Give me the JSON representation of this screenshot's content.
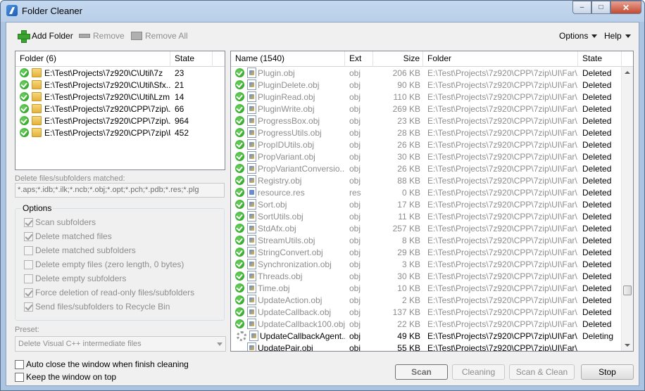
{
  "window": {
    "title": "Folder Cleaner",
    "minimize": "–",
    "maximize": "□",
    "close": "✕"
  },
  "toolbar": {
    "add_folder": "Add Folder",
    "remove": "Remove",
    "remove_all": "Remove All",
    "options": "Options",
    "help": "Help"
  },
  "folders": {
    "col_folder": "Folder (6)",
    "col_state": "State",
    "rows": [
      {
        "path": "E:\\Test\\Projects\\7z920\\C\\Util\\7z",
        "state": "23"
      },
      {
        "path": "E:\\Test\\Projects\\7z920\\C\\Util\\Sfx...",
        "state": "21"
      },
      {
        "path": "E:\\Test\\Projects\\7z920\\C\\Util\\Lzm...",
        "state": "14"
      },
      {
        "path": "E:\\Test\\Projects\\7z920\\CPP\\7zip\\...",
        "state": "66"
      },
      {
        "path": "E:\\Test\\Projects\\7z920\\CPP\\7zip\\...",
        "state": "964"
      },
      {
        "path": "E:\\Test\\Projects\\7z920\\CPP\\7zip\\UI",
        "state": "452"
      }
    ]
  },
  "delete_label": "Delete files/subfolders matched:",
  "delete_pattern": "*.aps;*.idb;*.ilk;*.ncb;*.obj;*.opt;*.pch;*.pdb;*.res;*.plg",
  "options": {
    "title": "Options",
    "items": [
      {
        "label": "Scan subfolders",
        "checked": true
      },
      {
        "label": "Delete matched files",
        "checked": true
      },
      {
        "label": "Delete matched subfolders",
        "checked": false
      },
      {
        "label": "Delete empty files (zero length, 0 bytes)",
        "checked": false
      },
      {
        "label": "Delete empty subfolders",
        "checked": false
      },
      {
        "label": "Force deletion of read-only files/subfolders",
        "checked": true
      },
      {
        "label": "Send files/subfolders to Recycle Bin",
        "checked": true
      }
    ]
  },
  "preset": {
    "label": "Preset:",
    "value": "Delete Visual C++ intermediate files"
  },
  "bottom_checks": [
    {
      "label": "Auto close the window when finish cleaning",
      "checked": false
    },
    {
      "label": "Keep the window on top",
      "checked": false
    }
  ],
  "buttons": {
    "scan": "Scan",
    "cleaning": "Cleaning",
    "scan_clean": "Scan & Clean",
    "stop": "Stop"
  },
  "files": {
    "col_name": "Name (1540)",
    "col_ext": "Ext",
    "col_size": "Size",
    "col_folder": "Folder",
    "col_state": "State",
    "rows": [
      {
        "name": "Plugin.obj",
        "ext": "obj",
        "size": "206 KB",
        "folder": "E:\\Test\\Projects\\7z920\\CPP\\7zip\\UI\\Far\\...",
        "state": "Deleted",
        "status": "done"
      },
      {
        "name": "PluginDelete.obj",
        "ext": "obj",
        "size": "90 KB",
        "folder": "E:\\Test\\Projects\\7z920\\CPP\\7zip\\UI\\Far\\...",
        "state": "Deleted",
        "status": "done"
      },
      {
        "name": "PluginRead.obj",
        "ext": "obj",
        "size": "110 KB",
        "folder": "E:\\Test\\Projects\\7z920\\CPP\\7zip\\UI\\Far\\...",
        "state": "Deleted",
        "status": "done"
      },
      {
        "name": "PluginWrite.obj",
        "ext": "obj",
        "size": "269 KB",
        "folder": "E:\\Test\\Projects\\7z920\\CPP\\7zip\\UI\\Far\\...",
        "state": "Deleted",
        "status": "done"
      },
      {
        "name": "ProgressBox.obj",
        "ext": "obj",
        "size": "23 KB",
        "folder": "E:\\Test\\Projects\\7z920\\CPP\\7zip\\UI\\Far\\...",
        "state": "Deleted",
        "status": "done"
      },
      {
        "name": "ProgressUtils.obj",
        "ext": "obj",
        "size": "28 KB",
        "folder": "E:\\Test\\Projects\\7z920\\CPP\\7zip\\UI\\Far\\...",
        "state": "Deleted",
        "status": "done"
      },
      {
        "name": "PropIDUtils.obj",
        "ext": "obj",
        "size": "26 KB",
        "folder": "E:\\Test\\Projects\\7z920\\CPP\\7zip\\UI\\Far\\...",
        "state": "Deleted",
        "status": "done"
      },
      {
        "name": "PropVariant.obj",
        "ext": "obj",
        "size": "30 KB",
        "folder": "E:\\Test\\Projects\\7z920\\CPP\\7zip\\UI\\Far\\...",
        "state": "Deleted",
        "status": "done"
      },
      {
        "name": "PropVariantConversio...",
        "ext": "obj",
        "size": "26 KB",
        "folder": "E:\\Test\\Projects\\7z920\\CPP\\7zip\\UI\\Far\\...",
        "state": "Deleted",
        "status": "done"
      },
      {
        "name": "Registry.obj",
        "ext": "obj",
        "size": "88 KB",
        "folder": "E:\\Test\\Projects\\7z920\\CPP\\7zip\\UI\\Far\\...",
        "state": "Deleted",
        "status": "done"
      },
      {
        "name": "resource.res",
        "ext": "res",
        "size": "0 KB",
        "folder": "E:\\Test\\Projects\\7z920\\CPP\\7zip\\UI\\Far\\...",
        "state": "Deleted",
        "status": "done",
        "res": true
      },
      {
        "name": "Sort.obj",
        "ext": "obj",
        "size": "17 KB",
        "folder": "E:\\Test\\Projects\\7z920\\CPP\\7zip\\UI\\Far\\...",
        "state": "Deleted",
        "status": "done"
      },
      {
        "name": "SortUtils.obj",
        "ext": "obj",
        "size": "11 KB",
        "folder": "E:\\Test\\Projects\\7z920\\CPP\\7zip\\UI\\Far\\...",
        "state": "Deleted",
        "status": "done"
      },
      {
        "name": "StdAfx.obj",
        "ext": "obj",
        "size": "257 KB",
        "folder": "E:\\Test\\Projects\\7z920\\CPP\\7zip\\UI\\Far\\...",
        "state": "Deleted",
        "status": "done"
      },
      {
        "name": "StreamUtils.obj",
        "ext": "obj",
        "size": "8 KB",
        "folder": "E:\\Test\\Projects\\7z920\\CPP\\7zip\\UI\\Far\\...",
        "state": "Deleted",
        "status": "done"
      },
      {
        "name": "StringConvert.obj",
        "ext": "obj",
        "size": "29 KB",
        "folder": "E:\\Test\\Projects\\7z920\\CPP\\7zip\\UI\\Far\\...",
        "state": "Deleted",
        "status": "done"
      },
      {
        "name": "Synchronization.obj",
        "ext": "obj",
        "size": "3 KB",
        "folder": "E:\\Test\\Projects\\7z920\\CPP\\7zip\\UI\\Far\\...",
        "state": "Deleted",
        "status": "done"
      },
      {
        "name": "Threads.obj",
        "ext": "obj",
        "size": "30 KB",
        "folder": "E:\\Test\\Projects\\7z920\\CPP\\7zip\\UI\\Far\\...",
        "state": "Deleted",
        "status": "done"
      },
      {
        "name": "Time.obj",
        "ext": "obj",
        "size": "10 KB",
        "folder": "E:\\Test\\Projects\\7z920\\CPP\\7zip\\UI\\Far\\...",
        "state": "Deleted",
        "status": "done"
      },
      {
        "name": "UpdateAction.obj",
        "ext": "obj",
        "size": "2 KB",
        "folder": "E:\\Test\\Projects\\7z920\\CPP\\7zip\\UI\\Far\\...",
        "state": "Deleted",
        "status": "done"
      },
      {
        "name": "UpdateCallback.obj",
        "ext": "obj",
        "size": "137 KB",
        "folder": "E:\\Test\\Projects\\7z920\\CPP\\7zip\\UI\\Far\\...",
        "state": "Deleted",
        "status": "done"
      },
      {
        "name": "UpdateCallback100.obj",
        "ext": "obj",
        "size": "22 KB",
        "folder": "E:\\Test\\Projects\\7z920\\CPP\\7zip\\UI\\Far\\...",
        "state": "Deleted",
        "status": "done"
      },
      {
        "name": "UpdateCallbackAgent...",
        "ext": "obj",
        "size": "49 KB",
        "folder": "E:\\Test\\Projects\\7z920\\CPP\\7zip\\UI\\Far\\...",
        "state": "Deleting",
        "status": "active"
      },
      {
        "name": "UpdatePair.obj",
        "ext": "obj",
        "size": "55 KB",
        "folder": "E:\\Test\\Projects\\7z920\\CPP\\7zip\\UI\\Far\\...",
        "state": "",
        "status": "pending"
      }
    ]
  }
}
